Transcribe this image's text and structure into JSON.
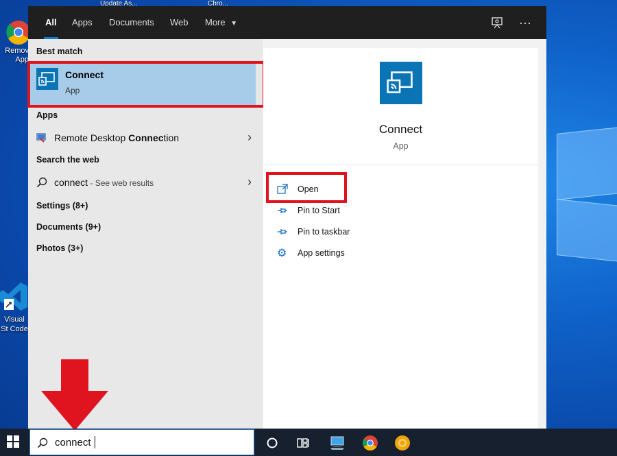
{
  "desktop": {
    "icons": [
      {
        "label": "Remov App"
      },
      {
        "label": "Visual St Code"
      }
    ],
    "top_labels": [
      "Update As...",
      "Chro..."
    ]
  },
  "tabs": [
    {
      "label": "All",
      "active": true
    },
    {
      "label": "Apps"
    },
    {
      "label": "Documents"
    },
    {
      "label": "Web"
    },
    {
      "label": "More"
    }
  ],
  "left": {
    "best_match_heading": "Best match",
    "best_match": {
      "title": "Connect",
      "subtitle": "App"
    },
    "apps_heading": "Apps",
    "apps": [
      {
        "label_pre": "Remote Desktop ",
        "label_bold": "Connec",
        "label_post": "tion"
      }
    ],
    "web_heading": "Search the web",
    "web": {
      "query": "connect",
      "hint": " - See web results"
    },
    "categories": [
      {
        "label": "Settings (8+)"
      },
      {
        "label": "Documents (9+)"
      },
      {
        "label": "Photos (3+)"
      }
    ]
  },
  "right": {
    "app_name": "Connect",
    "app_type": "App",
    "actions": [
      {
        "label": "Open",
        "icon": "open-icon"
      },
      {
        "label": "Pin to Start",
        "icon": "pin-icon"
      },
      {
        "label": "Pin to taskbar",
        "icon": "pin-icon"
      },
      {
        "label": "App settings",
        "icon": "gear-icon"
      }
    ]
  },
  "taskbar": {
    "search_value": "connect"
  },
  "colors": {
    "accent": "#0a7bd7",
    "highlight": "#e0141e",
    "tile": "#0b74b5",
    "best_match_bg": "#a7cce9"
  }
}
